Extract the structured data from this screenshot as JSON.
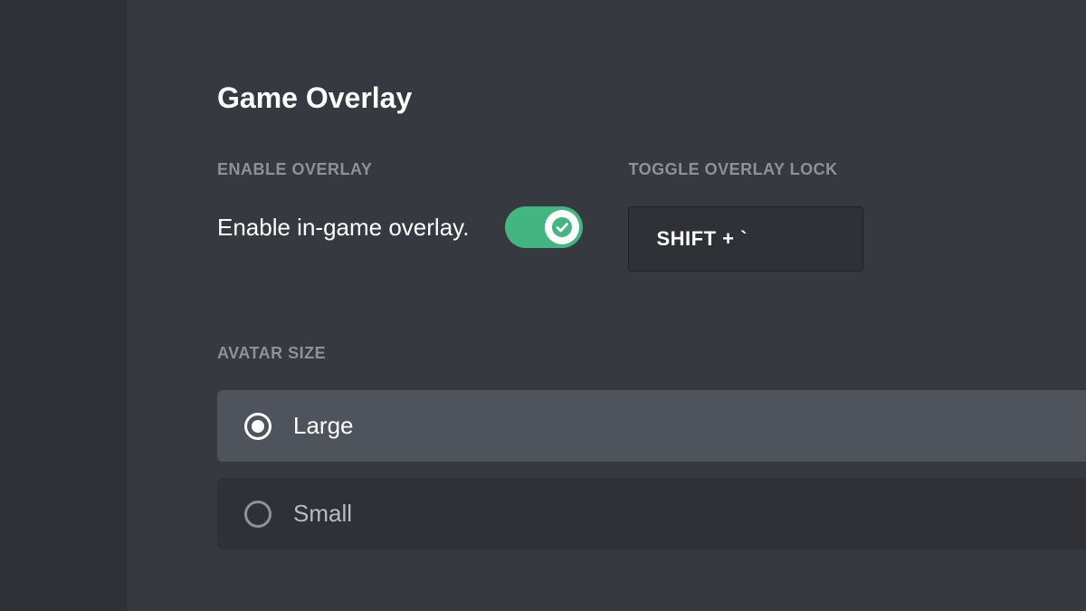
{
  "header": {
    "title": "Game Overlay"
  },
  "enableOverlay": {
    "eyebrow": "ENABLE OVERLAY",
    "label": "Enable in-game overlay.",
    "enabled": true
  },
  "toggleLock": {
    "eyebrow": "TOGGLE OVERLAY LOCK",
    "keybind": "SHIFT + `"
  },
  "avatarSize": {
    "eyebrow": "AVATAR SIZE",
    "options": [
      {
        "label": "Large",
        "selected": true
      },
      {
        "label": "Small",
        "selected": false
      }
    ]
  },
  "colors": {
    "toggleOn": "#43b581",
    "bgMain": "#36393f",
    "bgSidebar": "#2f3136",
    "bgSelected": "#4f545c"
  }
}
